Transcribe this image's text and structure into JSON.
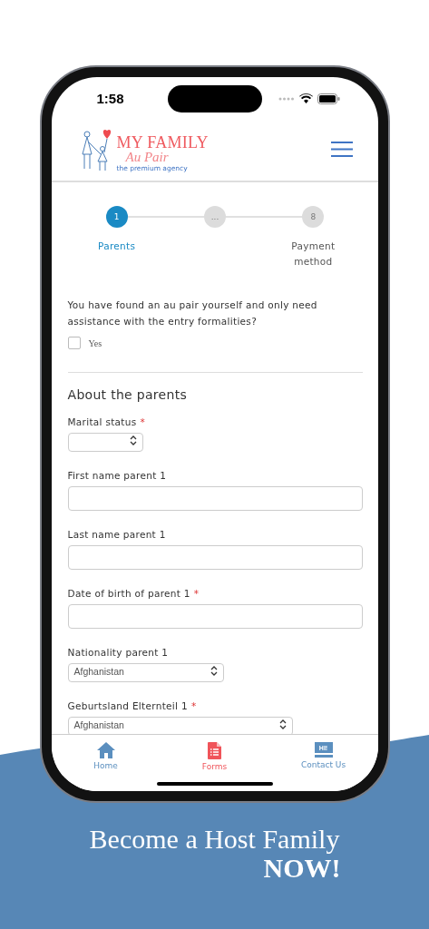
{
  "status_bar": {
    "time": "1:58"
  },
  "header": {
    "logo": {
      "title": "MY FAMILY",
      "script": "Au Pair",
      "tagline": "the premium agency"
    }
  },
  "stepper": [
    {
      "number": "1",
      "label": "Parents",
      "selected": true
    },
    {
      "number": "...",
      "selected": false
    },
    {
      "number": "8",
      "label": "Payment method",
      "selected": false
    }
  ],
  "question": {
    "text": "You have found an au pair yourself and only need assistance with the entry formalities?",
    "option": {
      "label": "Yes",
      "checked": false
    }
  },
  "section_title": "About the parents",
  "fields": [
    {
      "kind": "select",
      "label": "Marital status",
      "required_mark": "*"
    },
    {
      "kind": "text",
      "label": "First name parent 1"
    },
    {
      "kind": "text",
      "label": "Last name parent 1"
    },
    {
      "kind": "text",
      "label": "Date of birth of parent 1",
      "required_mark": "*"
    },
    {
      "kind": "select",
      "label": "Nationality parent 1",
      "value": "Afghanistan"
    },
    {
      "kind": "select",
      "label": "Geburtsland Elternteil 1",
      "required_mark": "*",
      "value": "Afghanistan"
    }
  ],
  "tab_bar": [
    {
      "label": "Home",
      "selected": false
    },
    {
      "label": "Forms",
      "selected": true
    },
    {
      "label": "Contact Us",
      "selected": false,
      "badge": "HI!"
    }
  ],
  "promo": {
    "headline": "Become a Host Family",
    "emphasis": "NOW!"
  }
}
